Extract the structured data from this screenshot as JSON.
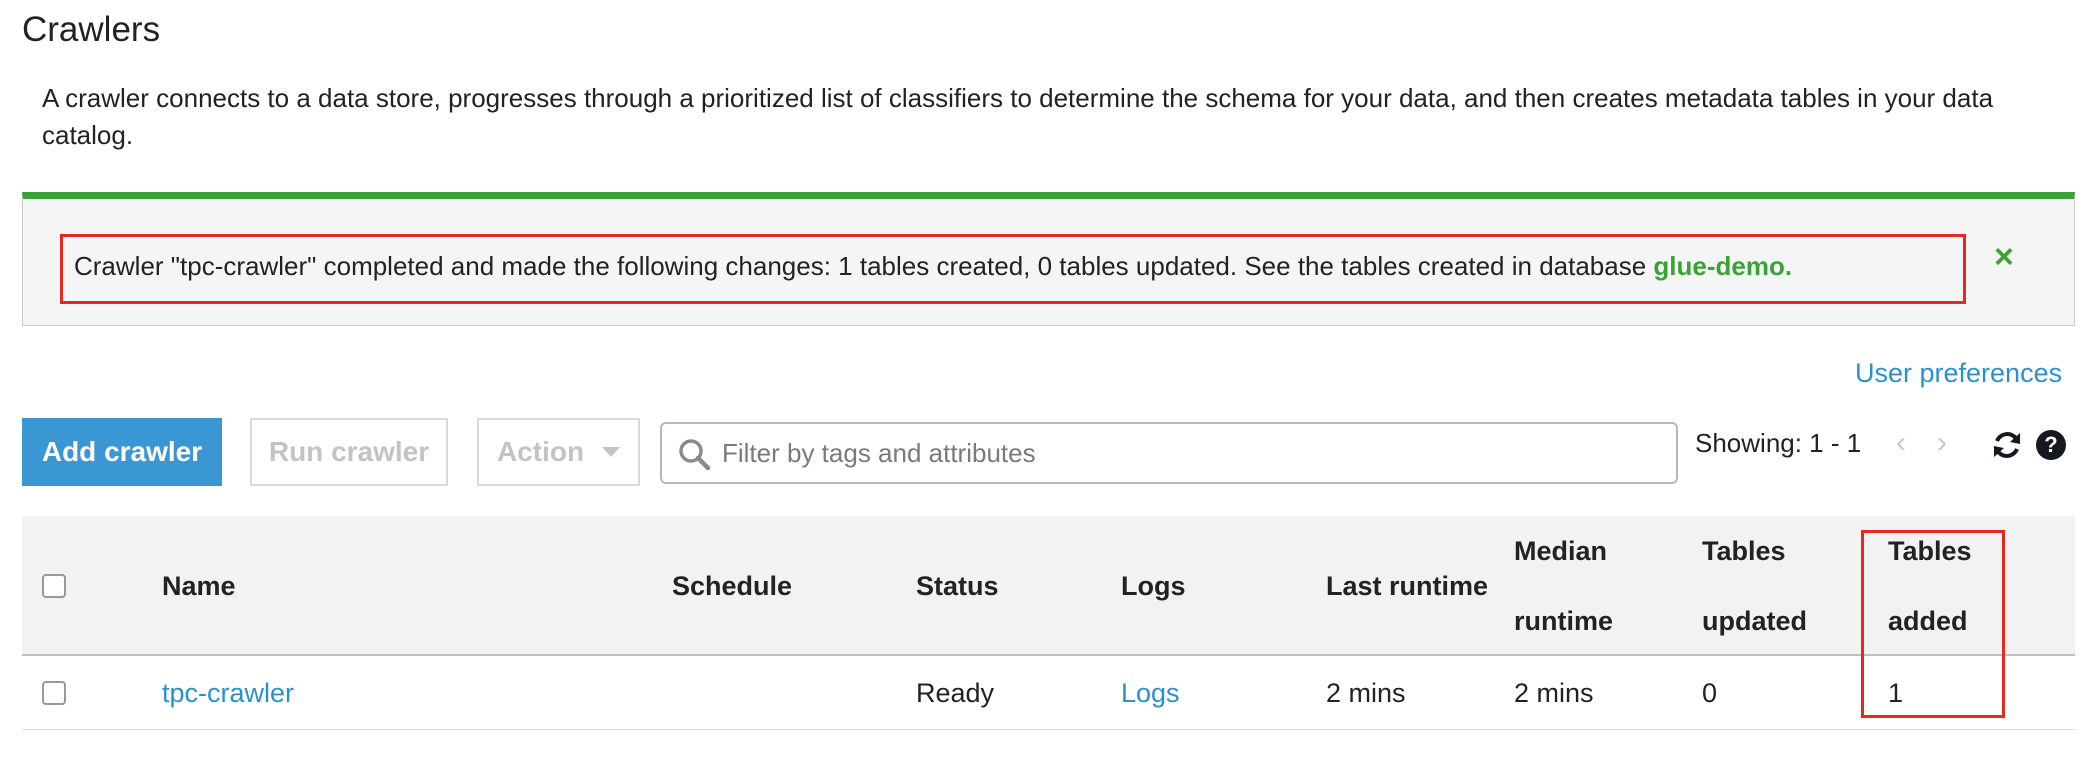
{
  "page": {
    "title": "Crawlers",
    "description": "A crawler connects to a data store, progresses through a prioritized list of classifiers to determine the schema for your data, and then creates metadata tables in your data catalog."
  },
  "flash": {
    "message": "Crawler \"tpc-crawler\" completed and made the following changes: 1 tables created, 0 tables updated. See the tables created in database ",
    "database_link": "glue-demo.",
    "close_icon": "×",
    "accent_color": "#3ca238"
  },
  "user_preferences": "User preferences",
  "toolbar": {
    "add_label": "Add crawler",
    "run_label": "Run crawler",
    "action_label": "Action",
    "search_placeholder": "Filter by tags and attributes",
    "showing": "Showing: 1 - 1",
    "prev_icon": "‹",
    "next_icon": "›",
    "help_icon": "?",
    "primary_color": "#3b96d4"
  },
  "table": {
    "headers": {
      "name": "Name",
      "schedule": "Schedule",
      "status": "Status",
      "logs": "Logs",
      "last_runtime": "Last runtime",
      "median_runtime_1": "Median",
      "median_runtime_2": "runtime",
      "tables_updated_1": "Tables",
      "tables_updated_2": "updated",
      "tables_added_1": "Tables",
      "tables_added_2": "added"
    },
    "rows": [
      {
        "name": "tpc-crawler",
        "schedule": "",
        "status": "Ready",
        "logs": "Logs",
        "last_runtime": "2 mins",
        "median_runtime": "2 mins",
        "tables_updated": "0",
        "tables_added": "1"
      }
    ]
  },
  "annotation_color": "#e5291f"
}
